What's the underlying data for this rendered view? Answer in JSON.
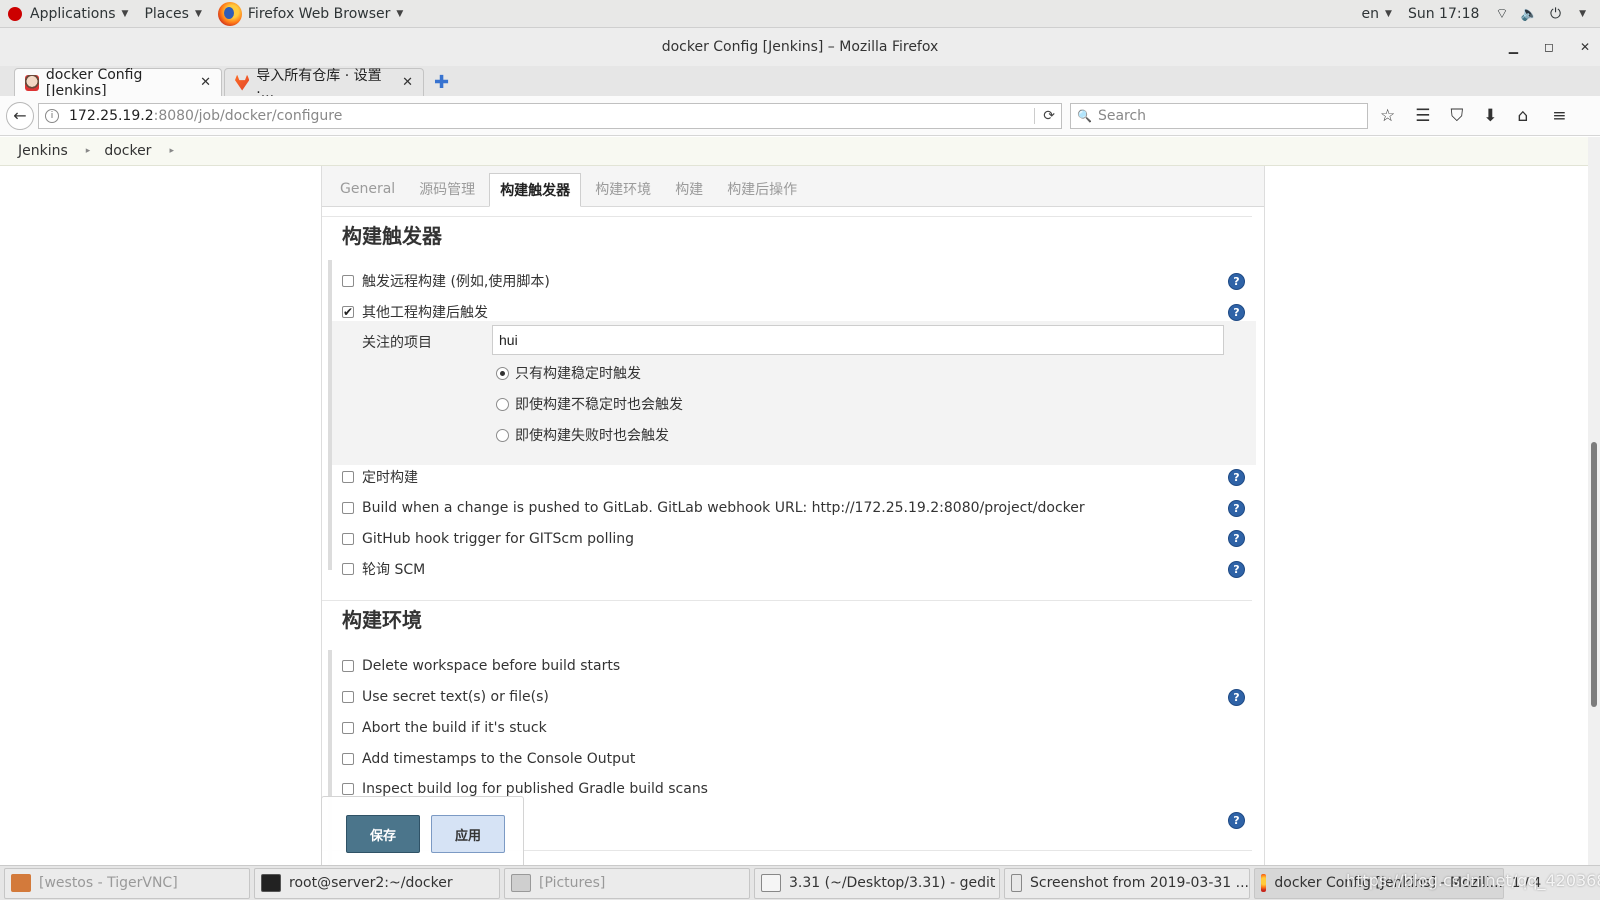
{
  "topbar": {
    "applications": "Applications",
    "places": "Places",
    "browser_app": "Firefox Web Browser",
    "lang": "en",
    "clock": "Sun 17:18"
  },
  "window": {
    "title": "docker Config [Jenkins] – Mozilla Firefox"
  },
  "browser_tabs": [
    {
      "label": "docker Config [Jenkins]"
    },
    {
      "label": "导入所有仓库 · 设置 ·..."
    }
  ],
  "url": {
    "host": "172.25.19.2",
    "path": ":8080/job/docker/configure"
  },
  "search": {
    "placeholder": "Search"
  },
  "breadcrumb": [
    "Jenkins",
    "docker"
  ],
  "config_tabs": [
    "General",
    "源码管理",
    "构建触发器",
    "构建环境",
    "构建",
    "构建后操作"
  ],
  "triggers": {
    "title": "构建触发器",
    "options": [
      {
        "label": "触发远程构建 (例如,使用脚本)",
        "checked": false
      },
      {
        "label": "其他工程构建后触发",
        "checked": true
      },
      {
        "label": "定时构建",
        "checked": false
      },
      {
        "label": "Build when a change is pushed to GitLab. GitLab webhook URL: http://172.25.19.2:8080/project/docker",
        "checked": false
      },
      {
        "label": "GitHub hook trigger for GITScm polling",
        "checked": false
      },
      {
        "label": "轮询 SCM",
        "checked": false
      }
    ],
    "watched_label": "关注的项目",
    "watched_value": "hui",
    "radios": [
      {
        "label": "只有构建稳定时触发",
        "selected": true
      },
      {
        "label": "即使构建不稳定时也会触发",
        "selected": false
      },
      {
        "label": "即使构建失败时也会触发",
        "selected": false
      }
    ]
  },
  "build_env": {
    "title": "构建环境",
    "options": [
      {
        "label": "Delete workspace before build starts"
      },
      {
        "label": "Use secret text(s) or file(s)"
      },
      {
        "label": "Abort the build if it's stuck"
      },
      {
        "label": "Add timestamps to the Console Output"
      },
      {
        "label": "Inspect build log for published Gradle build scans"
      }
    ]
  },
  "buttons": {
    "save": "保存",
    "apply": "应用"
  },
  "taskbar": [
    {
      "label": "[westos - TigerVNC]"
    },
    {
      "label": "root@server2:~/docker"
    },
    {
      "label": "[Pictures]"
    },
    {
      "label": "3.31 (~/Desktop/3.31) - gedit"
    },
    {
      "label": "Screenshot from 2019-03-31 ..."
    },
    {
      "label": "docker Config [Jenkins] - Mozill..."
    }
  ],
  "pager": "1 / 4",
  "watermark": "https://blog.csdn.net/qq_42036824",
  "colors": {
    "help_icon": "#2f63a7",
    "save_button": "#4b758b",
    "apply_button": "#d6e3f5"
  }
}
